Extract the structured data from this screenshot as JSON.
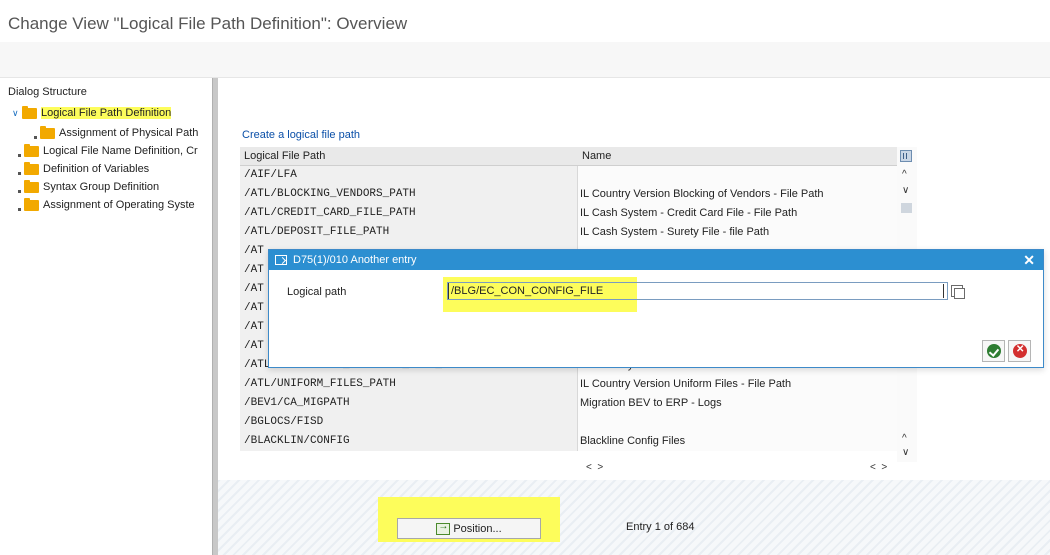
{
  "window": {
    "title": "Change View \"Logical File Path Definition\": Overview"
  },
  "dialog_structure": {
    "heading": "Dialog Structure",
    "items": [
      {
        "label": "Logical File Path Definition",
        "level": 0,
        "expanded": true,
        "selected": true
      },
      {
        "label": "Assignment of Physical Path",
        "level": 1
      },
      {
        "label": "Logical File Name Definition, Cr",
        "level": 0
      },
      {
        "label": "Definition of Variables",
        "level": 0
      },
      {
        "label": "Syntax Group Definition",
        "level": 0
      },
      {
        "label": "Assignment of Operating Syste",
        "level": 0
      }
    ]
  },
  "main": {
    "create_link": "Create a logical file path",
    "columns": [
      "Logical File Path",
      "Name"
    ],
    "rows": [
      {
        "path": "/AIF/LFA",
        "name": ""
      },
      {
        "path": "/ATL/BLOCKING_VENDORS_PATH",
        "name": "IL Country Version Blocking of Vendors - File Path"
      },
      {
        "path": "/ATL/CREDIT_CARD_FILE_PATH",
        "name": "IL Cash System - Credit Card File - File Path"
      },
      {
        "path": "/ATL/DEPOSIT_FILE_PATH",
        "name": "IL Cash System - Surety File - file Path"
      },
      {
        "path": "/AT",
        "name": ""
      },
      {
        "path": "/AT",
        "name": ""
      },
      {
        "path": "/AT",
        "name": ""
      },
      {
        "path": "/AT",
        "name": ""
      },
      {
        "path": "/AT",
        "name": ""
      },
      {
        "path": "/AT",
        "name": ""
      },
      {
        "path": "/ATL/RESTRICTED_ACCOUNTS_FILE_PATH",
        "name": "IL Cash System - Restricted Accounts File - File Path"
      },
      {
        "path": "/ATL/UNIFORM_FILES_PATH",
        "name": "IL Country Version Uniform Files - File Path"
      },
      {
        "path": "/BEV1/CA_MIGPATH",
        "name": "Migration BEV to ERP - Logs"
      },
      {
        "path": "/BGLOCS/FISD",
        "name": ""
      },
      {
        "path": "/BLACKLIN/CONFIG",
        "name": "Blackline Config Files"
      }
    ],
    "position_button": "Position...",
    "entry_info": "Entry 1 of 684"
  },
  "popup": {
    "title": "D75(1)/010 Another entry",
    "field_label": "Logical path",
    "field_value": "/BLG/EC_CON_CONFIG_FILE"
  },
  "colors": {
    "highlight": "#fdfd5b",
    "dialog_title": "#2c8fd1",
    "folder": "#f2a900",
    "link": "#0a4fa8"
  }
}
